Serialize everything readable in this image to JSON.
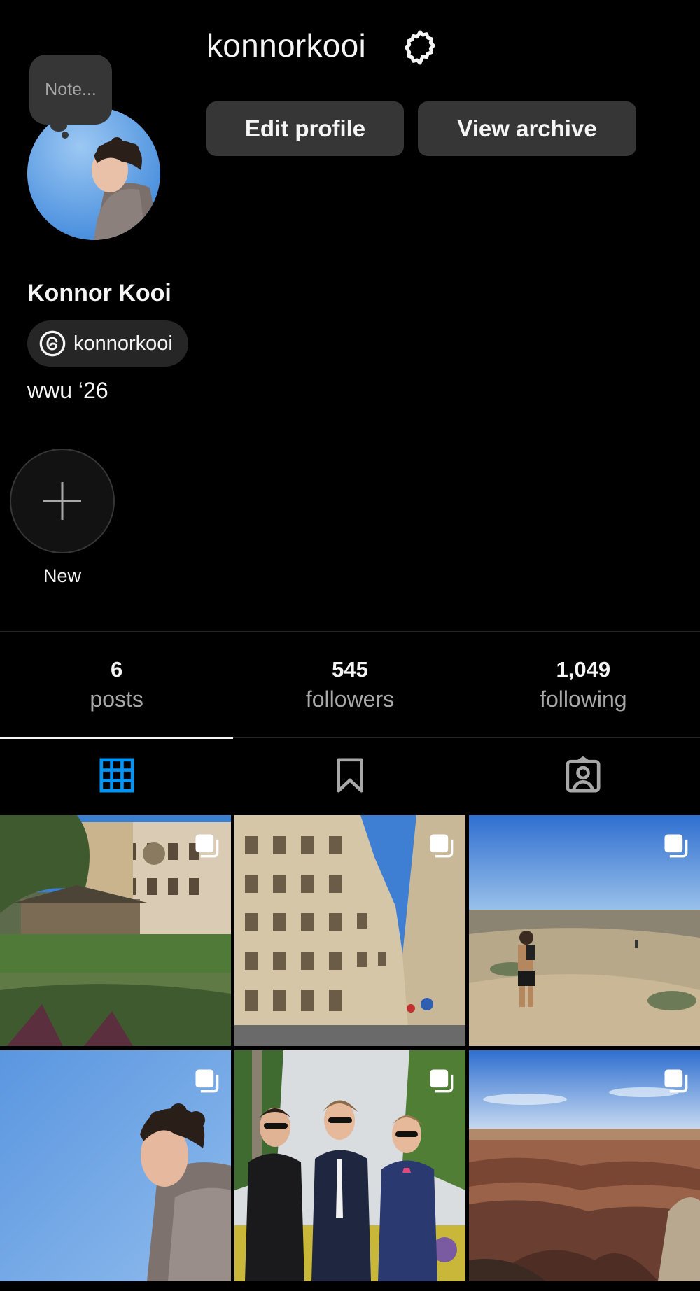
{
  "profile": {
    "username": "konnorkooi",
    "full_name": "Konnor Kooi",
    "threads_handle": "konnorkooi",
    "bio": "wwu ‘26",
    "note_placeholder": "Note..."
  },
  "buttons": {
    "edit_profile": "Edit profile",
    "view_archive": "View archive"
  },
  "highlights": {
    "new_label": "New"
  },
  "stats": [
    {
      "value": "6",
      "label": "posts"
    },
    {
      "value": "545",
      "label": "followers"
    },
    {
      "value": "1,049",
      "label": "following"
    }
  ],
  "tabs": [
    {
      "icon": "grid-icon",
      "active": true
    },
    {
      "icon": "bookmark-icon",
      "active": false
    },
    {
      "icon": "tagged-icon",
      "active": false
    }
  ],
  "posts": [
    {
      "scene": "old town canal with stone building",
      "multi": true
    },
    {
      "scene": "Paris street apartment buildings",
      "multi": true
    },
    {
      "scene": "hiker on desert trail",
      "multi": true
    },
    {
      "scene": "portrait against blue sky",
      "multi": true
    },
    {
      "scene": "three friends in suits",
      "multi": true
    },
    {
      "scene": "canyon landscape",
      "multi": true
    }
  ],
  "colors": {
    "background": "#000000",
    "button_bg": "#363636",
    "secondary_text": "#a8a8a8",
    "accent_blue": "#0095f6"
  }
}
